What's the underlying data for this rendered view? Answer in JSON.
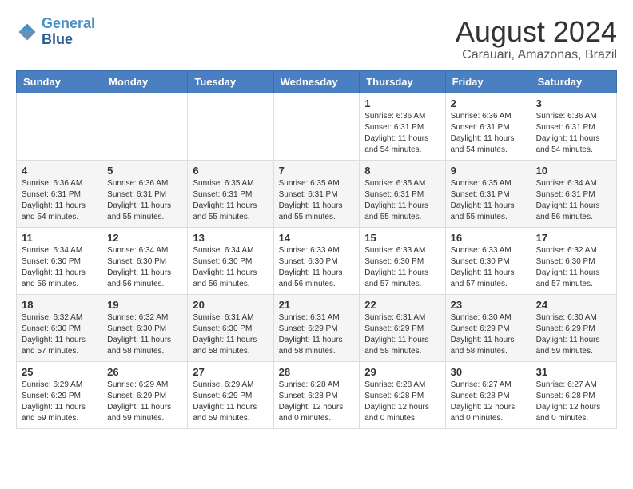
{
  "header": {
    "logo_line1": "General",
    "logo_line2": "Blue",
    "title": "August 2024",
    "subtitle": "Carauari, Amazonas, Brazil"
  },
  "days_of_week": [
    "Sunday",
    "Monday",
    "Tuesday",
    "Wednesday",
    "Thursday",
    "Friday",
    "Saturday"
  ],
  "weeks": [
    [
      {
        "day": "",
        "info": ""
      },
      {
        "day": "",
        "info": ""
      },
      {
        "day": "",
        "info": ""
      },
      {
        "day": "",
        "info": ""
      },
      {
        "day": "1",
        "info": "Sunrise: 6:36 AM\nSunset: 6:31 PM\nDaylight: 11 hours\nand 54 minutes."
      },
      {
        "day": "2",
        "info": "Sunrise: 6:36 AM\nSunset: 6:31 PM\nDaylight: 11 hours\nand 54 minutes."
      },
      {
        "day": "3",
        "info": "Sunrise: 6:36 AM\nSunset: 6:31 PM\nDaylight: 11 hours\nand 54 minutes."
      }
    ],
    [
      {
        "day": "4",
        "info": "Sunrise: 6:36 AM\nSunset: 6:31 PM\nDaylight: 11 hours\nand 54 minutes."
      },
      {
        "day": "5",
        "info": "Sunrise: 6:36 AM\nSunset: 6:31 PM\nDaylight: 11 hours\nand 55 minutes."
      },
      {
        "day": "6",
        "info": "Sunrise: 6:35 AM\nSunset: 6:31 PM\nDaylight: 11 hours\nand 55 minutes."
      },
      {
        "day": "7",
        "info": "Sunrise: 6:35 AM\nSunset: 6:31 PM\nDaylight: 11 hours\nand 55 minutes."
      },
      {
        "day": "8",
        "info": "Sunrise: 6:35 AM\nSunset: 6:31 PM\nDaylight: 11 hours\nand 55 minutes."
      },
      {
        "day": "9",
        "info": "Sunrise: 6:35 AM\nSunset: 6:31 PM\nDaylight: 11 hours\nand 55 minutes."
      },
      {
        "day": "10",
        "info": "Sunrise: 6:34 AM\nSunset: 6:31 PM\nDaylight: 11 hours\nand 56 minutes."
      }
    ],
    [
      {
        "day": "11",
        "info": "Sunrise: 6:34 AM\nSunset: 6:30 PM\nDaylight: 11 hours\nand 56 minutes."
      },
      {
        "day": "12",
        "info": "Sunrise: 6:34 AM\nSunset: 6:30 PM\nDaylight: 11 hours\nand 56 minutes."
      },
      {
        "day": "13",
        "info": "Sunrise: 6:34 AM\nSunset: 6:30 PM\nDaylight: 11 hours\nand 56 minutes."
      },
      {
        "day": "14",
        "info": "Sunrise: 6:33 AM\nSunset: 6:30 PM\nDaylight: 11 hours\nand 56 minutes."
      },
      {
        "day": "15",
        "info": "Sunrise: 6:33 AM\nSunset: 6:30 PM\nDaylight: 11 hours\nand 57 minutes."
      },
      {
        "day": "16",
        "info": "Sunrise: 6:33 AM\nSunset: 6:30 PM\nDaylight: 11 hours\nand 57 minutes."
      },
      {
        "day": "17",
        "info": "Sunrise: 6:32 AM\nSunset: 6:30 PM\nDaylight: 11 hours\nand 57 minutes."
      }
    ],
    [
      {
        "day": "18",
        "info": "Sunrise: 6:32 AM\nSunset: 6:30 PM\nDaylight: 11 hours\nand 57 minutes."
      },
      {
        "day": "19",
        "info": "Sunrise: 6:32 AM\nSunset: 6:30 PM\nDaylight: 11 hours\nand 58 minutes."
      },
      {
        "day": "20",
        "info": "Sunrise: 6:31 AM\nSunset: 6:30 PM\nDaylight: 11 hours\nand 58 minutes."
      },
      {
        "day": "21",
        "info": "Sunrise: 6:31 AM\nSunset: 6:29 PM\nDaylight: 11 hours\nand 58 minutes."
      },
      {
        "day": "22",
        "info": "Sunrise: 6:31 AM\nSunset: 6:29 PM\nDaylight: 11 hours\nand 58 minutes."
      },
      {
        "day": "23",
        "info": "Sunrise: 6:30 AM\nSunset: 6:29 PM\nDaylight: 11 hours\nand 58 minutes."
      },
      {
        "day": "24",
        "info": "Sunrise: 6:30 AM\nSunset: 6:29 PM\nDaylight: 11 hours\nand 59 minutes."
      }
    ],
    [
      {
        "day": "25",
        "info": "Sunrise: 6:29 AM\nSunset: 6:29 PM\nDaylight: 11 hours\nand 59 minutes."
      },
      {
        "day": "26",
        "info": "Sunrise: 6:29 AM\nSunset: 6:29 PM\nDaylight: 11 hours\nand 59 minutes."
      },
      {
        "day": "27",
        "info": "Sunrise: 6:29 AM\nSunset: 6:29 PM\nDaylight: 11 hours\nand 59 minutes."
      },
      {
        "day": "28",
        "info": "Sunrise: 6:28 AM\nSunset: 6:28 PM\nDaylight: 12 hours\nand 0 minutes."
      },
      {
        "day": "29",
        "info": "Sunrise: 6:28 AM\nSunset: 6:28 PM\nDaylight: 12 hours\nand 0 minutes."
      },
      {
        "day": "30",
        "info": "Sunrise: 6:27 AM\nSunset: 6:28 PM\nDaylight: 12 hours\nand 0 minutes."
      },
      {
        "day": "31",
        "info": "Sunrise: 6:27 AM\nSunset: 6:28 PM\nDaylight: 12 hours\nand 0 minutes."
      }
    ]
  ]
}
